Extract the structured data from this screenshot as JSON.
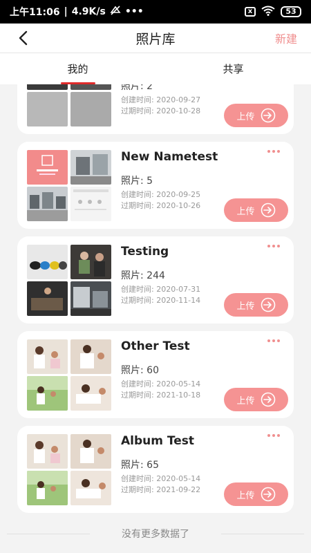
{
  "status_bar": {
    "time": "上午11:06",
    "speed": "4.9K/s",
    "dots": "•••",
    "battery": "53",
    "sim_label": "x"
  },
  "header": {
    "title": "照片库",
    "new_label": "新建"
  },
  "tabs": [
    {
      "label": "我的",
      "active": true
    },
    {
      "label": "共享",
      "active": false
    }
  ],
  "albums": [
    {
      "title": "",
      "count": "照片: 2",
      "created": "创建时间: 2020-09-27",
      "expire": "过期时间: 2020-10-28",
      "upload_label": "上传"
    },
    {
      "title": "New Nametest",
      "count": "照片: 5",
      "created": "创建时间: 2020-09-25",
      "expire": "过期时间: 2020-10-26",
      "upload_label": "上传"
    },
    {
      "title": "Testing",
      "count": "照片: 244",
      "created": "创建时间: 2020-07-31",
      "expire": "过期时间: 2020-11-14",
      "upload_label": "上传"
    },
    {
      "title": "Other Test",
      "count": "照片: 60",
      "created": "创建时间: 2020-05-14",
      "expire": "过期时间: 2021-10-18",
      "upload_label": "上传"
    },
    {
      "title": "Album Test",
      "count": "照片: 65",
      "created": "创建时间: 2020-05-14",
      "expire": "过期时间: 2021-09-22",
      "upload_label": "上传"
    }
  ],
  "footer": {
    "text": "没有更多数据了"
  },
  "colors": {
    "accent": "#f59393",
    "accent_text": "#f08f8f",
    "tab_underline": "#e02b2b"
  }
}
